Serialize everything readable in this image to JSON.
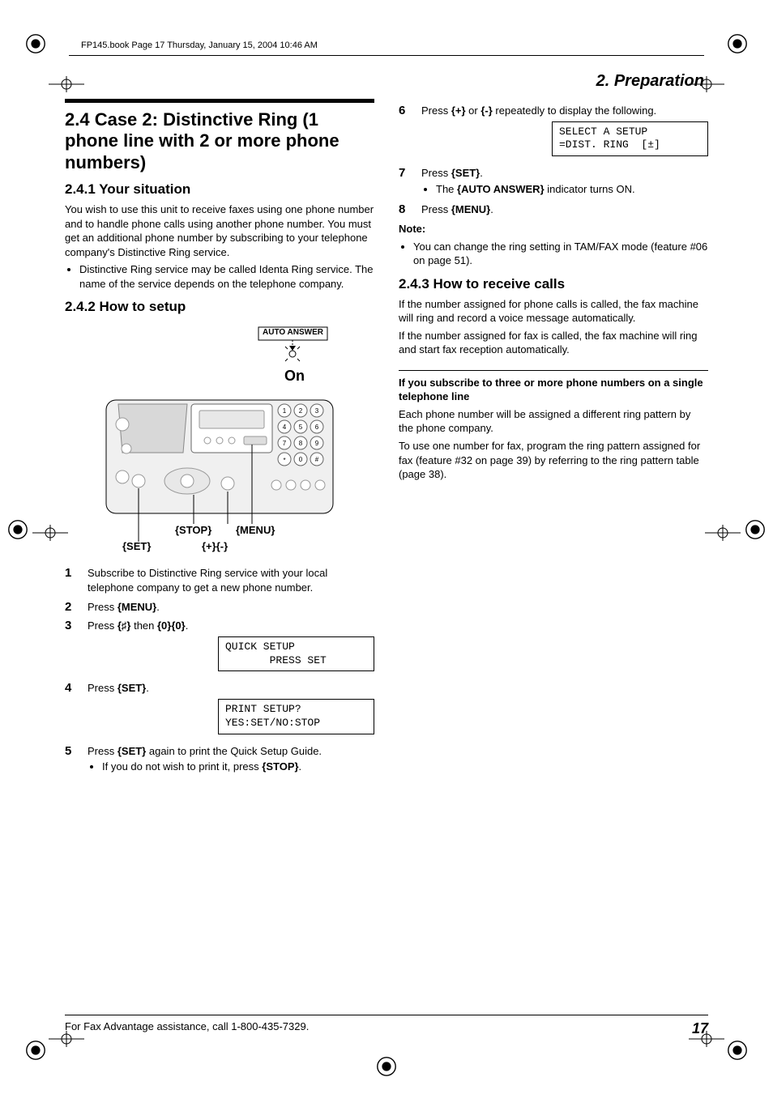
{
  "print_header": "FP145.book  Page 17  Thursday, January 15, 2004  10:46 AM",
  "chapter": "2. Preparation",
  "section24": {
    "title": "2.4 Case 2: Distinctive Ring (1 phone line with 2 or more phone numbers)",
    "s241_title": "2.4.1 Your situation",
    "s241_body": "You wish to use this unit to receive faxes using one phone number and to handle phone calls using another phone number. You must get an additional phone number by subscribing to your telephone company's Distinctive Ring service.",
    "s241_bullet": "Distinctive Ring service may be called Identa Ring service. The name of the service depends on the telephone company.",
    "s242_title": "2.4.2 How to setup",
    "diagram": {
      "auto_answer": "AUTO ANSWER",
      "on": "On",
      "stop": "{STOP}",
      "menu": "{MENU}",
      "set": "{SET}",
      "plusminus": "{+}{-}"
    },
    "steps": {
      "1": "Subscribe to Distinctive Ring service with your local telephone company to get a new phone number.",
      "2_a": "Press ",
      "2_b": "{MENU}",
      "2_c": ".",
      "3_a": "Press ",
      "3_b": "{♯}",
      "3_c": " then ",
      "3_d": "{0}{0}",
      "3_e": ".",
      "lcd1_l1": "QUICK SETUP",
      "lcd1_l2": "       PRESS SET",
      "4_a": "Press ",
      "4_b": "{SET}",
      "4_c": ".",
      "lcd2_l1": "PRINT SETUP?",
      "lcd2_l2": "YES:SET/NO:STOP",
      "5_a": "Press ",
      "5_b": "{SET}",
      "5_c": " again to print the Quick Setup Guide.",
      "5_bullet_a": "If you do not wish to print it, press ",
      "5_bullet_b": "{STOP}",
      "5_bullet_c": ".",
      "6_a": "Press ",
      "6_b": "{+}",
      "6_c": " or ",
      "6_d": "{-}",
      "6_e": " repeatedly to display the following.",
      "lcd3_l1": "SELECT A SETUP",
      "lcd3_l2": "=DIST. RING  [±]",
      "7_a": "Press ",
      "7_b": "{SET}",
      "7_c": ".",
      "7_bullet_a": "The ",
      "7_bullet_b": "{AUTO ANSWER}",
      "7_bullet_c": " indicator turns ON.",
      "8_a": "Press ",
      "8_b": "{MENU}",
      "8_c": "."
    },
    "note_label": "Note:",
    "note_bullet": "You can change the ring setting in TAM/FAX mode (feature #06 on page 51).",
    "s243_title": "2.4.3 How to receive calls",
    "s243_p1": "If the number assigned for phone calls is called, the fax machine will ring and record a voice message automatically.",
    "s243_p2": "If the number assigned for fax is called, the fax machine will ring and start fax reception automatically.",
    "s243_sub_bold": "If you subscribe to three or more phone numbers on a single telephone line",
    "s243_sub_p1": "Each phone number will be assigned a different ring pattern by the phone company.",
    "s243_sub_p2": "To use one number for fax, program the ring pattern assigned for fax (feature #32 on page 39) by referring to the ring pattern table (page 38)."
  },
  "footer": {
    "text": "For Fax Advantage assistance, call 1-800-435-7329.",
    "page": "17"
  }
}
